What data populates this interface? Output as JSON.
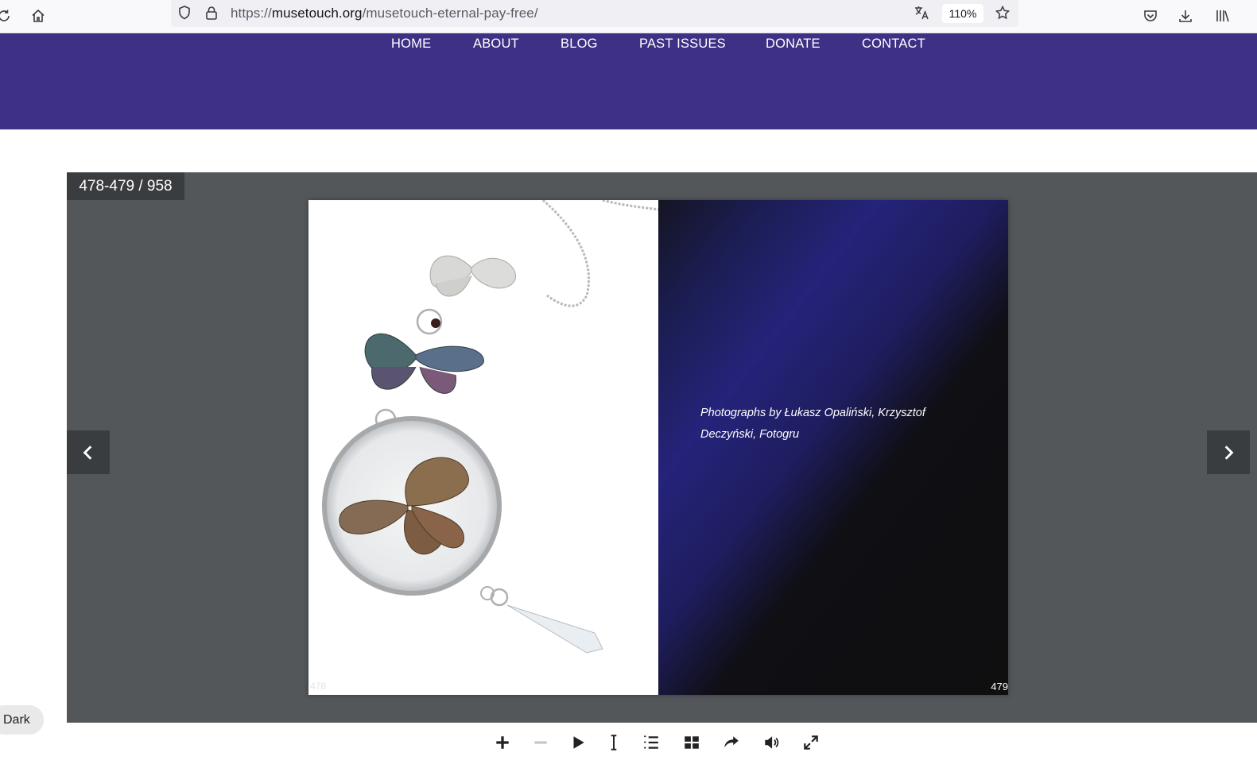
{
  "browser": {
    "url_scheme": "https://",
    "url_host": "musetouch.org",
    "url_path": "/musetouch-eternal-pay-free/",
    "zoom": "110%"
  },
  "nav": {
    "items": [
      {
        "label": "HOME"
      },
      {
        "label": "ABOUT"
      },
      {
        "label": "BLOG"
      },
      {
        "label": "PAST ISSUES"
      },
      {
        "label": "DONATE"
      },
      {
        "label": "CONTACT"
      }
    ]
  },
  "flipbook": {
    "page_counter": "478-479 / 958",
    "left_page_number": "478",
    "right_page_number": "479",
    "caption_line1": "Photographs by Łukasz Opaliński, Krzysztof",
    "caption_line2": "Deczyński, Fotogru"
  },
  "dark_toggle": {
    "label": "Dark"
  },
  "colors": {
    "nav_background": "#3e3085",
    "viewer_background": "#53575a",
    "counter_background": "#3a3d40"
  }
}
